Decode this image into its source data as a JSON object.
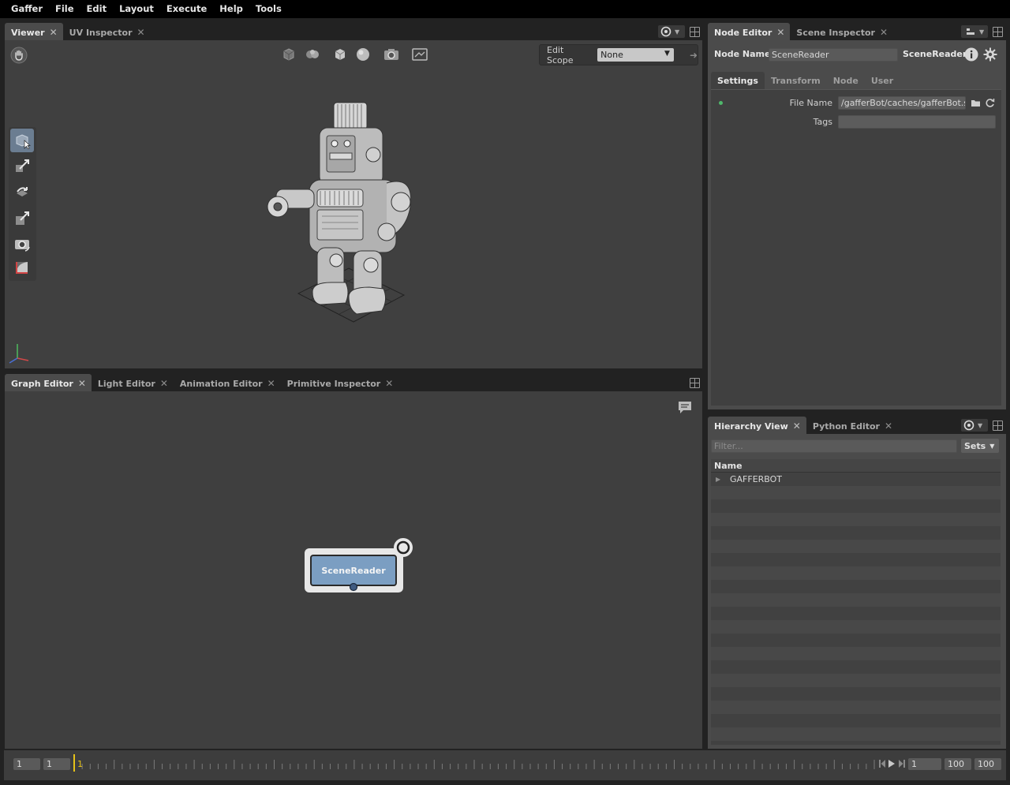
{
  "menubar": {
    "items": [
      "Gaffer",
      "File",
      "Edit",
      "Layout",
      "Execute",
      "Help",
      "Tools"
    ]
  },
  "viewer_panel": {
    "tabs": [
      {
        "label": "Viewer",
        "active": true
      },
      {
        "label": "UV Inspector",
        "active": false
      }
    ],
    "edit_scope": {
      "label": "Edit Scope",
      "value": "None"
    },
    "top_icons": [
      "object-cube-icon",
      "objects-icon",
      "wireframe-cube-icon",
      "solid-sphere-icon",
      "camera-icon",
      "render-display-icon"
    ],
    "tools": [
      "selection-tool-icon",
      "translate-tool-icon",
      "rotate-tool-icon",
      "scale-tool-icon",
      "camera-tool-icon",
      "crop-window-tool-icon"
    ]
  },
  "node_editor_panel": {
    "tabs": [
      {
        "label": "Node Editor",
        "active": true
      },
      {
        "label": "Scene Inspector",
        "active": false
      }
    ],
    "node_name_label": "Node Name",
    "node_name_value": "SceneReader",
    "node_type": "SceneReader",
    "sections": [
      "Settings",
      "Transform",
      "Node",
      "User"
    ],
    "params": {
      "file_name_label": "File Name",
      "file_name_value": "/gafferBot/caches/gafferBot.scc",
      "tags_label": "Tags",
      "tags_value": ""
    }
  },
  "graph_panel": {
    "tabs": [
      {
        "label": "Graph Editor",
        "active": true
      },
      {
        "label": "Light Editor",
        "active": false
      },
      {
        "label": "Animation Editor",
        "active": false
      },
      {
        "label": "Primitive Inspector",
        "active": false
      }
    ],
    "node_label": "SceneReader"
  },
  "hierarchy_panel": {
    "tabs": [
      {
        "label": "Hierarchy View",
        "active": true
      },
      {
        "label": "Python Editor",
        "active": false
      }
    ],
    "filter_placeholder": "Filter...",
    "sets_label": "Sets",
    "column_name": "Name",
    "rows": [
      "GAFFERBOT"
    ]
  },
  "timeline": {
    "start_outer": "1",
    "start_inner": "1",
    "current_frame": "1",
    "frame_field": "1",
    "end_inner": "100",
    "end_outer": "100"
  },
  "colors": {
    "accent_selected": "#6b7d91",
    "node_fill": "#7b9ec2",
    "playhead": "#e6c219",
    "active_dot": "#4fb86b"
  }
}
